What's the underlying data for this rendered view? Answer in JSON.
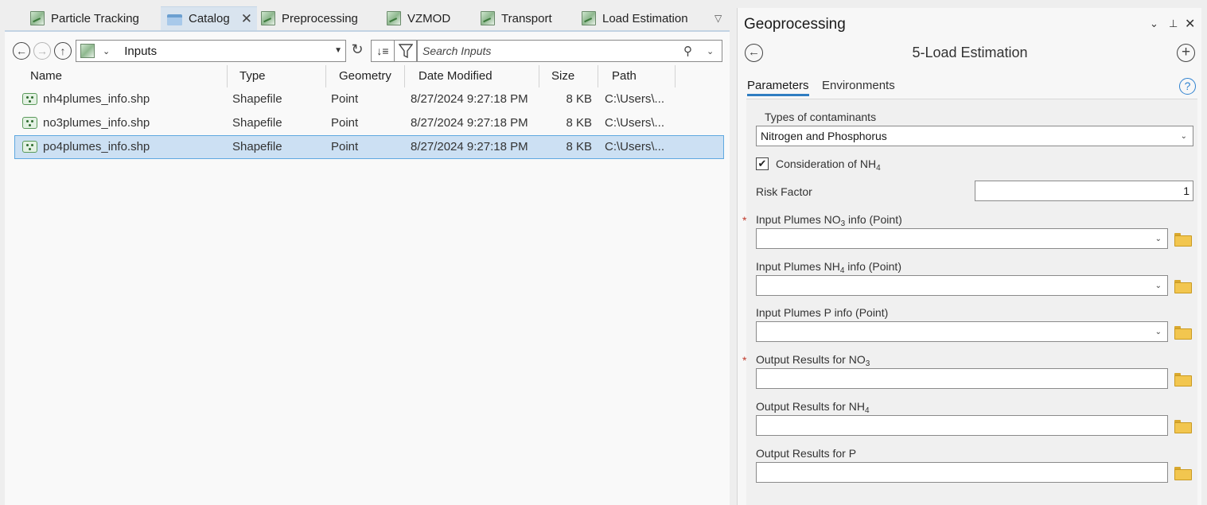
{
  "tabs": [
    {
      "label": "Particle Tracking",
      "active": false
    },
    {
      "label": "Catalog",
      "active": true
    },
    {
      "label": "Preprocessing",
      "active": false
    },
    {
      "label": "VZMOD",
      "active": false
    },
    {
      "label": "Transport",
      "active": false
    },
    {
      "label": "Load Estimation",
      "active": false
    }
  ],
  "catalog": {
    "location": "Inputs",
    "search_placeholder": "Search Inputs",
    "columns": [
      "Name",
      "Type",
      "Geometry",
      "Date Modified",
      "Size",
      "Path"
    ],
    "rows": [
      {
        "name": "nh4plumes_info.shp",
        "type": "Shapefile",
        "geometry": "Point",
        "date_modified": "8/27/2024 9:27:18 PM",
        "size": "8 KB",
        "path": "C:\\Users\\...",
        "selected": false
      },
      {
        "name": "no3plumes_info.shp",
        "type": "Shapefile",
        "geometry": "Point",
        "date_modified": "8/27/2024 9:27:18 PM",
        "size": "8 KB",
        "path": "C:\\Users\\...",
        "selected": false
      },
      {
        "name": "po4plumes_info.shp",
        "type": "Shapefile",
        "geometry": "Point",
        "date_modified": "8/27/2024 9:27:18 PM",
        "size": "8 KB",
        "path": "C:\\Users\\...",
        "selected": true
      }
    ]
  },
  "gp": {
    "title": "Geoprocessing",
    "tool_name": "5-Load Estimation",
    "tabs": [
      "Parameters",
      "Environments"
    ],
    "types_label": "Types of contaminants",
    "types_value": "Nitrogen and Phosphorus",
    "consider_label_prefix": "Consideration of NH",
    "consider_sub": "4",
    "consider_checked": true,
    "risk_label": "Risk Factor",
    "risk_value": "1",
    "in_no3_prefix": "Input Plumes NO",
    "in_no3_sub": "3",
    "in_no3_suffix": " info (Point)",
    "in_nh4_prefix": "Input Plumes NH",
    "in_nh4_sub": "4",
    "in_nh4_suffix": " info (Point)",
    "in_p_label": "Input Plumes P info (Point)",
    "out_no3_prefix": "Output Results for NO",
    "out_no3_sub": "3",
    "out_nh4_prefix": "Output Results for NH",
    "out_nh4_sub": "4",
    "out_p_label": "Output Results for P",
    "required_mark": "*"
  }
}
